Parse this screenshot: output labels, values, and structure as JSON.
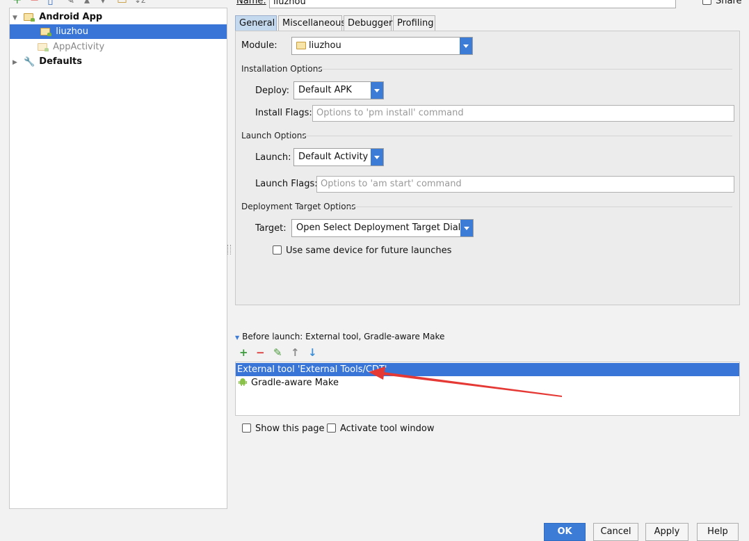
{
  "tree": {
    "root": "Android App",
    "children": [
      "liuzhou",
      "AppActivity"
    ],
    "defaults": "Defaults"
  },
  "name_row": {
    "label": "Name:",
    "value": "liuzhou",
    "share": "Share"
  },
  "tabs": [
    "General",
    "Miscellaneous",
    "Debugger",
    "Profiling"
  ],
  "general": {
    "module_label": "Module:",
    "module_value": "liuzhou",
    "installation_title": "Installation Options",
    "deploy_label": "Deploy:",
    "deploy_value": "Default APK",
    "install_flags_label": "Install Flags:",
    "install_flags_placeholder": "Options to 'pm install' command",
    "launch_title": "Launch Options",
    "launch_label": "Launch:",
    "launch_value": "Default Activity",
    "launch_flags_label": "Launch Flags:",
    "launch_flags_placeholder": "Options to 'am start' command",
    "target_title": "Deployment Target Options",
    "target_label": "Target:",
    "target_value": "Open Select Deployment Target Dialog",
    "same_device_label": "Use same device for future launches"
  },
  "before_launch": {
    "title": "Before launch: External tool, Gradle-aware Make",
    "items": [
      "External tool 'External Tools/CDT'",
      "Gradle-aware Make"
    ]
  },
  "options": {
    "show_page": "Show this page",
    "activate_tool": "Activate tool window"
  },
  "buttons": {
    "ok": "OK",
    "cancel": "Cancel",
    "apply": "Apply",
    "help": "Help"
  },
  "colors": {
    "selection": "#3875d7",
    "accent": "#3d7cd6",
    "annotation_arrow": "#e53935"
  }
}
